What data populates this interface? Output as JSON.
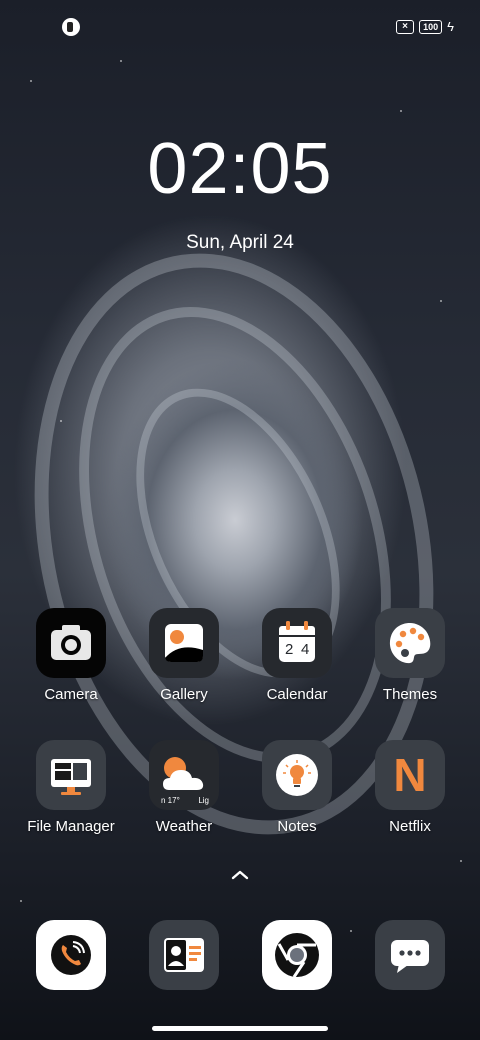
{
  "clock": {
    "time": "02:05",
    "date": "Sun, April 24"
  },
  "status": {
    "battery": "100"
  },
  "apps_row1": [
    {
      "name": "Camera",
      "icon": "camera-icon"
    },
    {
      "name": "Gallery",
      "icon": "gallery-icon"
    },
    {
      "name": "Calendar",
      "icon": "calendar-icon"
    },
    {
      "name": "Themes",
      "icon": "palette-icon"
    }
  ],
  "apps_row2": [
    {
      "name": "File Manager",
      "icon": "monitor-icon"
    },
    {
      "name": "Weather",
      "icon": "weather-icon"
    },
    {
      "name": "Notes",
      "icon": "lightbulb-icon"
    },
    {
      "name": "Netflix",
      "icon": "netflix-icon"
    }
  ],
  "calendar": {
    "digit1": "2",
    "digit2": "4"
  },
  "weather": {
    "temp": "n 17°",
    "cond": "Lig"
  },
  "netflix": {
    "letter": "N"
  },
  "dock": [
    {
      "icon": "phone-icon"
    },
    {
      "icon": "contacts-icon"
    },
    {
      "icon": "chrome-icon"
    },
    {
      "icon": "messages-icon"
    }
  ],
  "colors": {
    "accent": "#f0883e",
    "tile_dark": "#26292e",
    "tile_gray": "#3a3f46"
  }
}
